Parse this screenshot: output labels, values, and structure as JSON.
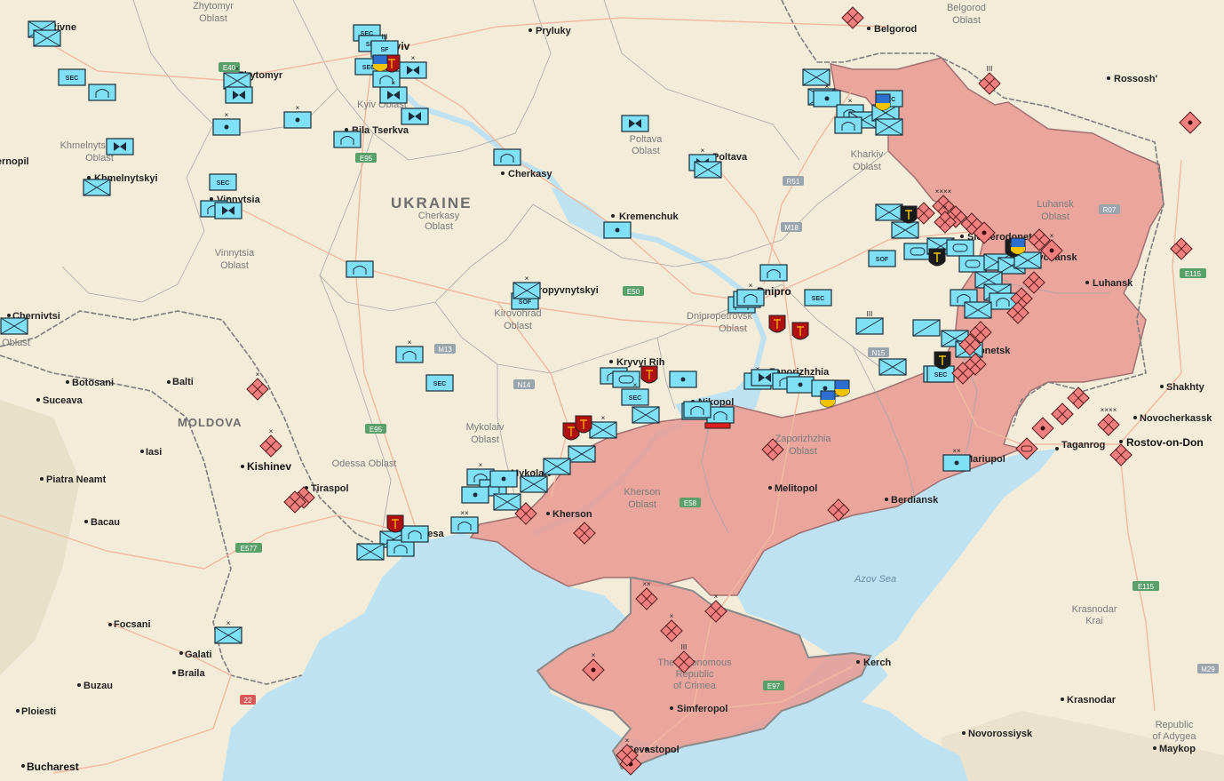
{
  "colors": {
    "land": "#f3ecd9",
    "sea": "#bfe2f2",
    "occupied": "#e89a92",
    "ua_unit": "#80e0f6",
    "ru_unit": "#f08080",
    "roads": "#f2b9a0",
    "borders": "#9a9a9a"
  },
  "labels": {
    "country": {
      "ukraine": "UKRAINE",
      "moldova": "MOLDOVA"
    },
    "sea": {
      "azov": "Azov Sea"
    },
    "cities": {
      "rivne": "Rivne",
      "zhytomyr": "Zhytomyr",
      "kyiv": "Kyiv",
      "pryluky": "Pryluky",
      "belgorod": "Belgorod",
      "rossosh": "Rossosh'",
      "bila_tserkva": "Bila Tserkva",
      "khmelnytskyi": "Khmelnytskyi",
      "vinnytsia": "Vinnytsia",
      "ternopil": "Ternopil",
      "cherkasy": "Cherkasy",
      "poltava": "Poltava",
      "kremenchuk": "Kremenchuk",
      "kropyvnytskyi": "Kropyvnytskyi",
      "dnipro": "Dnipro",
      "kryvyi_rih": "Kryvyi Rih",
      "zaporizhzhia": "Zaporizhzhia",
      "nikopol": "Nikopol",
      "sievierodonetsk": "Sievierodonetsk",
      "lysychansk": "Lysychansk",
      "luhansk": "Luhansk",
      "donetsk": "Donetsk",
      "chernivtsi": "Chernivtsi",
      "botosani": "Botosani",
      "balti": "Balti",
      "suceava": "Suceava",
      "iasi": "Iasi",
      "kishinev": "Kishinev",
      "piatra_neamt": "Piatra Neamt",
      "tiraspol": "Tiraspol",
      "odesa": "Odesa",
      "mykolaiv": "Mykolaiv",
      "kherson": "Kherson",
      "melitopol": "Melitopol",
      "berdiansk": "Berdiansk",
      "mariupol": "Mariupol",
      "taganrog": "Taganrog",
      "rostov": "Rostov-on-Don",
      "novocherkassk": "Novocherkassk",
      "shakhty": "Shakhty",
      "bacau": "Bacau",
      "focsani": "Focsani",
      "galati": "Galati",
      "braila": "Braila",
      "buzau": "Buzau",
      "ploiesti": "Ploiesti",
      "bucharest": "Bucharest",
      "simferopol": "Simferopol",
      "kerch": "Kerch",
      "sevastopol": "Sevastopol",
      "novorossiysk": "Novorossiysk",
      "krasnodar": "Krasnodar",
      "maykop": "Maykop"
    },
    "oblasts": {
      "zhytomyr_a": "Zhytomyr",
      "zhytomyr_b": "Oblast",
      "belgorod_a": "Belgorod",
      "belgorod_b": "Oblast",
      "kyiv": "Kyiv Oblast",
      "khmel_a": "Khmelnytskyi",
      "khmel_b": "Oblast",
      "vinnytsia_a": "Vinnytsia",
      "vinnytsia_b": "Oblast",
      "cherkasy_a": "Cherkasy",
      "cherkasy_b": "Oblast",
      "poltava_a": "Poltava",
      "poltava_b": "Oblast",
      "kharkiv_a": "Kharkiv",
      "kharkiv_b": "Oblast",
      "luhansk_a": "Luhansk",
      "luhansk_b": "Oblast",
      "kirovohrad_a": "Kirovohrad",
      "kirovohrad_b": "Oblast",
      "dnipro_a": "Dnipropetrovsk",
      "dnipro_b": "Oblast",
      "chernivtsi": "Oblast",
      "mykolaiv_a": "Mykolaiv",
      "mykolaiv_b": "Oblast",
      "odessa": "Odessa Oblast",
      "kherson_a": "Kherson",
      "kherson_b": "Oblast",
      "zap_a": "Zaporizhzhia",
      "zap_b": "Oblast",
      "crimea_a": "The Autonomous",
      "crimea_b": "Republic",
      "crimea_c": "of Crimea",
      "krasnodar_a": "Krasnodar",
      "krasnodar_b": "Krai",
      "adygea_a": "Republic",
      "adygea_b": "of Adygea"
    },
    "roads": [
      "E40",
      "E95",
      "R51",
      "M18",
      "R07",
      "E115",
      "E50",
      "M13",
      "N14",
      "N15",
      "E95",
      "E58",
      "E577",
      "E97",
      "E115",
      "M29",
      "22"
    ]
  },
  "unit_markers": {
    "sec": "SEC",
    "sof": "SOF",
    "sf": "SF",
    "size_xx": "××",
    "size_xxxx": "××××",
    "size_x": "×",
    "size_iii": "III"
  }
}
